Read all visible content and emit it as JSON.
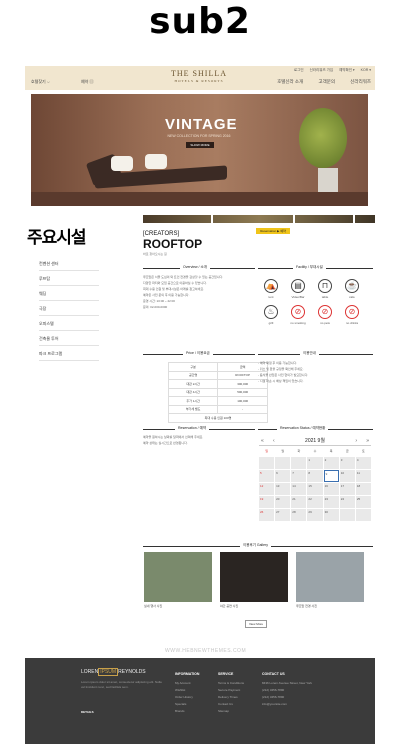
{
  "page_label": "sub2",
  "header": {
    "lang": "호텔찾기 ⌵",
    "reserve": "예약 ▤",
    "logo_main": "THE SHILLA",
    "logo_sub": "HOTELS & RESORTS",
    "util": [
      "로그인",
      "신라리워즈 가입",
      "예약확인 ▾",
      "KOR ▾"
    ],
    "gnb": [
      "호텔신라 소개",
      "고객문의",
      "신라리워즈"
    ]
  },
  "hero": {
    "title": "VINTAGE",
    "subtitle": "NEW COLLECTION FOR SPRING 2016",
    "button": "SHOW MORE"
  },
  "sidebar": {
    "title": "주요시설",
    "items": [
      "컨벤션 센터",
      "루프탑",
      "웨딩",
      "극장",
      "오피스텔",
      "건축물 투어",
      "파크 프로그램"
    ]
  },
  "content": {
    "badge": "Reservation ▶ 예약",
    "creators": "[CREATORS]",
    "venue": "ROOFTOP",
    "venue_sub": "바로 찾아오시는 길",
    "overview_title": "Overview / 소개",
    "overview_lines": [
      "루프탑은 서울 도심의 탁 트인 전경을 감상할 수 있는 공간입니다.",
      "다양한 파티와 모임 공간으로 이용하실 수 있습니다.",
      "최대 수용 인원 및 부대시설은 아래를 참고하세요.",
      "예약은 사전 문의 후 이용 가능합니다.",
      "운영 시간: 10:00 ~ 22:00",
      "문의: 02-000-0000"
    ],
    "facility_title": "Facility / 부대시설",
    "facilities": [
      {
        "icon": "⛺",
        "label": "tent",
        "no": false
      },
      {
        "icon": "▤",
        "label": "Video/Bar",
        "no": false
      },
      {
        "icon": "⊓",
        "label": "table",
        "no": false
      },
      {
        "icon": "☕",
        "label": "cafe",
        "no": false
      },
      {
        "icon": "♨",
        "label": "grill",
        "no": false
      },
      {
        "icon": "⊘",
        "label": "no smoking",
        "no": true
      },
      {
        "icon": "⊘",
        "label": "no pets",
        "no": true
      },
      {
        "icon": "⊘",
        "label": "no drinks",
        "no": true
      }
    ],
    "price_title": "Price / 이용요금",
    "price_rows": [
      [
        "구분",
        "금액"
      ],
      [
        "공간명",
        "ROOFTOP"
      ],
      [
        "대관 2시간",
        "300,000"
      ],
      [
        "대관 4시간",
        "500,000"
      ],
      [
        "추가 1시간",
        "100,000"
      ],
      [
        "부가세 별도",
        "-"
      ],
      [
        "최대 수용 인원 100명",
        ""
      ]
    ],
    "guide_title": "이용안내",
    "guide_lines": [
      "- 예약 확정 후 이용 가능합니다.",
      "- 취소 및 환불 규정을 확인해 주세요.",
      "- 음식물 반입은 사전 협의가 필요합니다.",
      "- 시설 파손 시 배상 책임이 있습니다."
    ],
    "reservation_title": "Reservation / 예약",
    "reservation_lines": [
      "예약을 원하시는 날짜를 달력에서 선택해 주세요.",
      "예약 상태는 실시간으로 반영됩니다."
    ],
    "status_title": "Reservation Status / 예약현황",
    "calendar_month": "2021 9월",
    "calendar_weekdays": [
      "일",
      "월",
      "화",
      "수",
      "목",
      "금",
      "토"
    ],
    "calendar_days": [
      "",
      "",
      "",
      "1",
      "2",
      "3",
      "4",
      "5",
      "6",
      "7",
      "8",
      "9",
      "10",
      "11",
      "12",
      "13",
      "14",
      "15",
      "16",
      "17",
      "18",
      "19",
      "20",
      "21",
      "22",
      "23",
      "24",
      "25",
      "26",
      "27",
      "28",
      "29",
      "30",
      "",
      ""
    ],
    "gallery_title": "이용후기 Gallery",
    "gallery": [
      {
        "caption": "실내 행사 사진",
        "color": "#7a8a6c"
      },
      {
        "caption": "야간 공연 사진",
        "color": "#2a2522"
      },
      {
        "caption": "루프탑 전경 사진",
        "color": "#9aa3a8"
      }
    ],
    "view_more": "View More"
  },
  "watermark": "WWW.HEBNEWTHEMES.COM",
  "footer": {
    "logo_a": "LOREN",
    "logo_box": "IPSUM",
    "logo_b": "REYNOLDS",
    "about": "Lorem ipsum dolor sit amet, consectetur adipiscing elit. Nulla vel tincidunt nunc, sed facilisis sem.",
    "details": "DETAILS",
    "col1_head": "INFORMATION",
    "col1": [
      "My Account",
      "Wishlist",
      "Order History",
      "Specials",
      "Brands"
    ],
    "col2_head": "SERVICE",
    "col2": [
      "Terms & Conditions",
      "Secure Payment",
      "Delivery Times",
      "Contact Us",
      "Sitemap"
    ],
    "col3_head": "CONTACT US",
    "col3": [
      "8436 Lorem Avenue Street, New York",
      "(212) 3456-7890",
      "(212) 3456-7890",
      "info@yoursite.com"
    ]
  }
}
